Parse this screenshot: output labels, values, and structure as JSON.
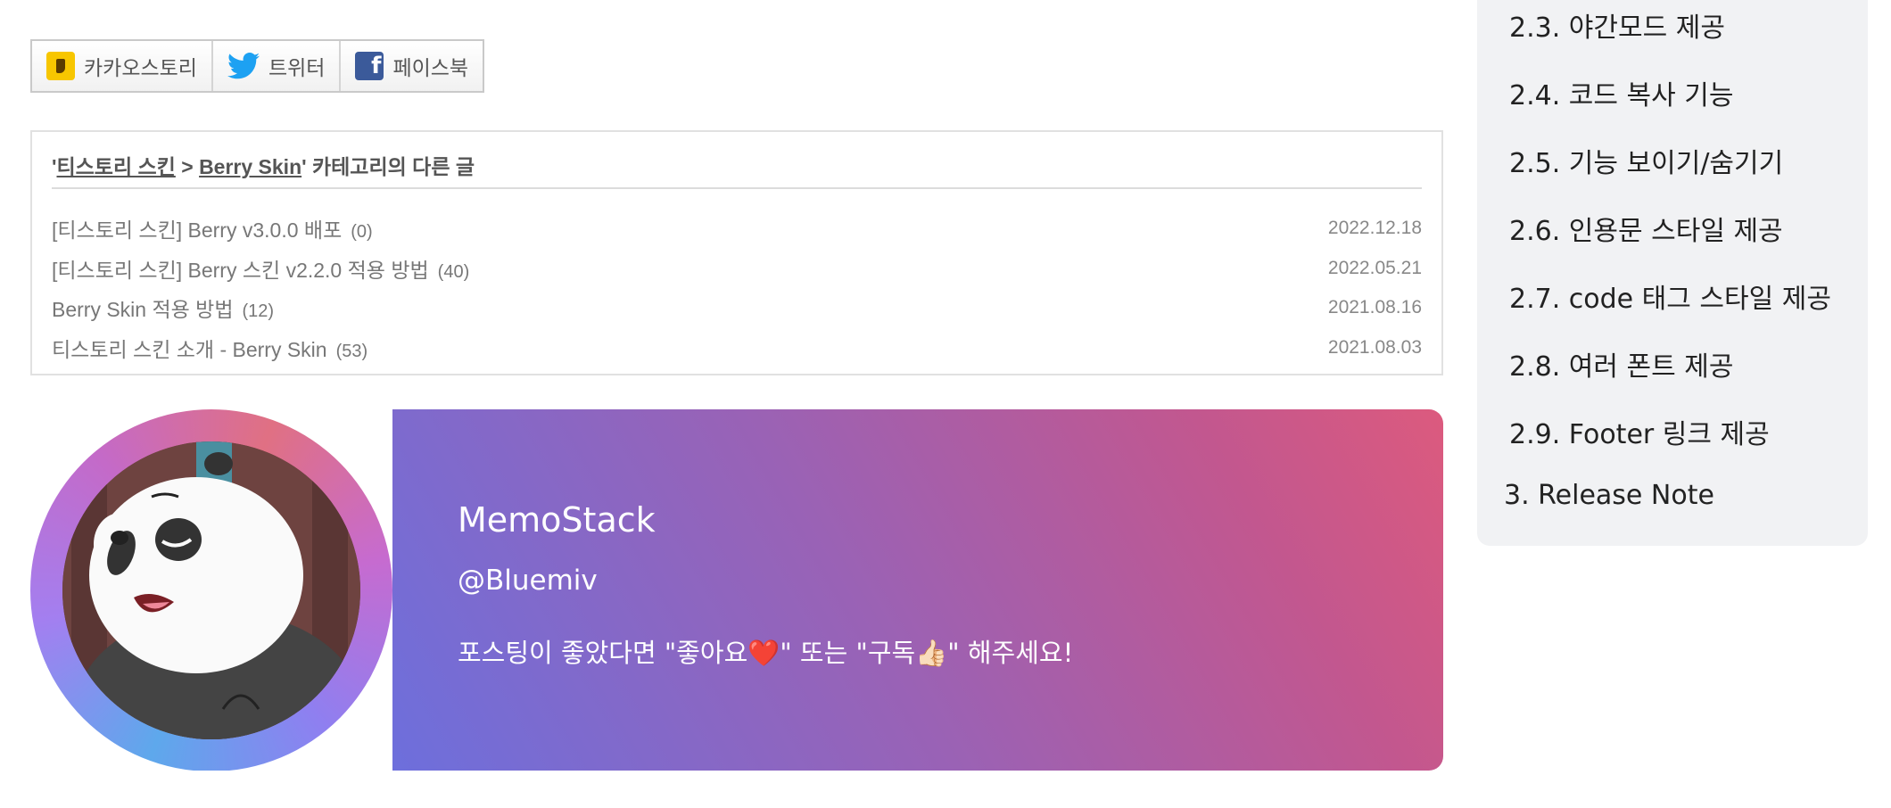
{
  "share": {
    "kakao": "카카오스토리",
    "twitter": "트위터",
    "facebook": "페이스북"
  },
  "related": {
    "head_prefix": "'",
    "category": "티스토리 스킨",
    "separator": " > ",
    "subcategory": "Berry Skin",
    "head_suffix": "' 카테고리의 다른 글",
    "posts": [
      {
        "title": "[티스토리 스킨] Berry v3.0.0 배포",
        "count": "(0)",
        "date": "2022.12.18"
      },
      {
        "title": "[티스토리 스킨] Berry 스킨 v2.2.0 적용 방법",
        "count": "(40)",
        "date": "2022.05.21"
      },
      {
        "title": "Berry Skin 적용 방법",
        "count": "(12)",
        "date": "2021.08.16"
      },
      {
        "title": "티스토리 스킨 소개 - Berry Skin",
        "count": "(53)",
        "date": "2021.08.03"
      }
    ]
  },
  "profile": {
    "blog_name": "MemoStack",
    "handle": "@Bluemiv",
    "bio": "포스팅이 좋았다면 \"좋아요❤️\" 또는 \"구독👍🏻\" 해주세요!"
  },
  "toc": {
    "items": [
      {
        "label": "2.3. 야간모드 제공"
      },
      {
        "label": "2.4. 코드 복사 기능"
      },
      {
        "label": "2.5. 기능 보이기/숨기기"
      },
      {
        "label": "2.6. 인용문 스타일 제공"
      },
      {
        "label": "2.7. code 태그 스타일 제공"
      },
      {
        "label": "2.8. 여러 폰트 제공"
      },
      {
        "label": "2.9. Footer 링크 제공"
      },
      {
        "label": "3. Release Note"
      }
    ]
  },
  "colors": {
    "gradient_start": "#6d6fdc",
    "gradient_end": "#dc5a7e",
    "toc_bg": "#f1f2f4"
  }
}
